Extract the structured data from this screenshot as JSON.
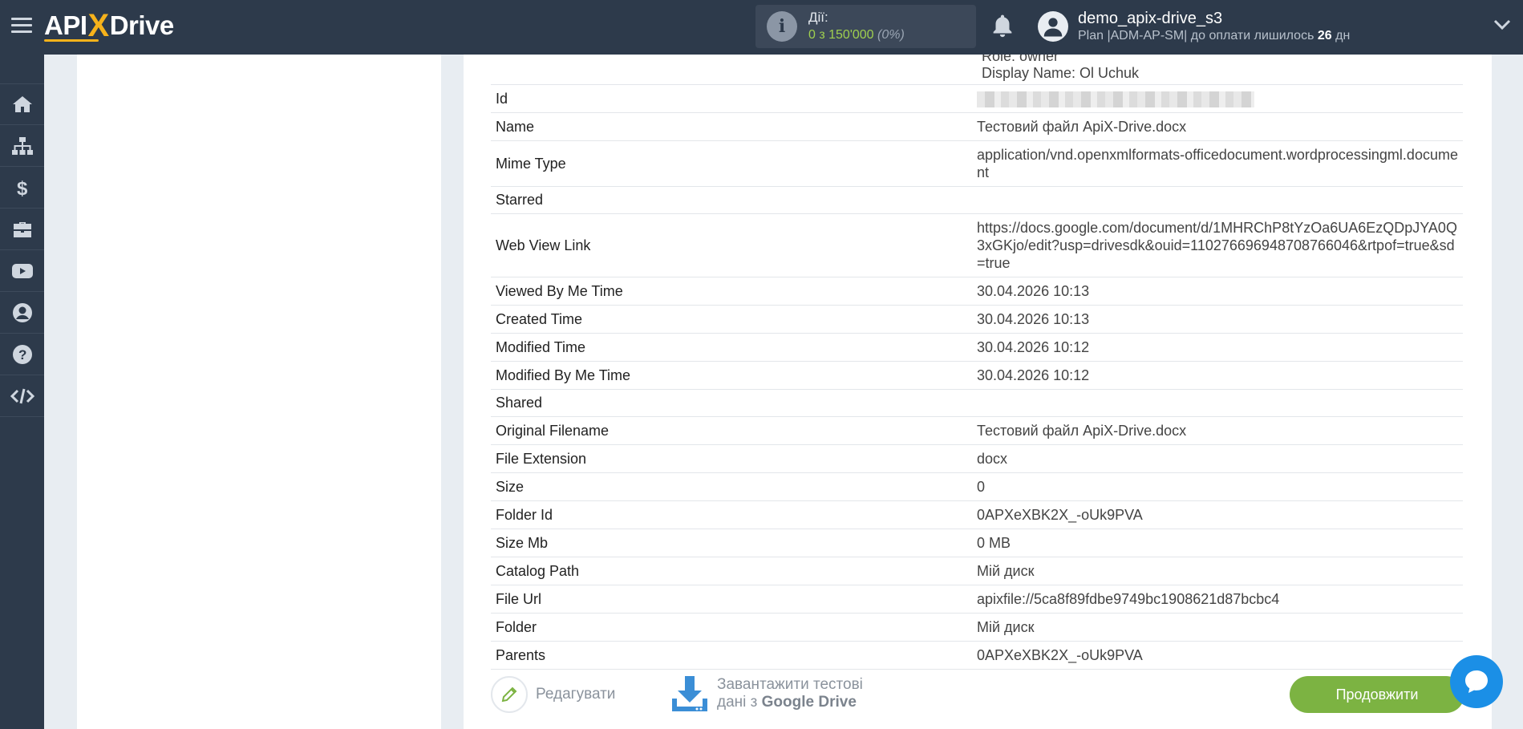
{
  "header": {
    "logo_text_left": "API",
    "logo_text_x": "X",
    "logo_text_right": "Drive",
    "actions_title": "Дії:",
    "actions_count": "0 з 150'000",
    "actions_percent": "(0%)",
    "user_name": "demo_apix-drive_s3",
    "user_plan": "Plan |ADM-AP-SM| до оплати лишилось",
    "user_days": "26",
    "user_days_unit": "дн"
  },
  "sidebar": {
    "items": [
      "home-icon",
      "sitemap-icon",
      "dollar-icon",
      "briefcase-icon",
      "youtube-icon",
      "user-icon",
      "help-icon",
      "code-icon"
    ]
  },
  "details": {
    "clipped_line": "Role: owner",
    "display_name": "Display Name: Ol Uchuk",
    "rows": [
      {
        "key": "Id",
        "value": ""
      },
      {
        "key": "Name",
        "value": "Тестовий файл ApiX-Drive.docx"
      },
      {
        "key": "Mime Type",
        "value": "application/vnd.openxmlformats-officedocument.wordprocessingml.document"
      },
      {
        "key": "Starred",
        "value": ""
      },
      {
        "key": "Web View Link",
        "value": "https://docs.google.com/document/d/1MHRChP8tYzOa6UA6EzQDpJYA0Q3xGKjo/edit?usp=drivesdk&ouid=110276696948708766046&rtpof=true&sd=true"
      },
      {
        "key": "Viewed By Me Time",
        "value": "30.04.2026 10:13"
      },
      {
        "key": "Created Time",
        "value": "30.04.2026 10:13"
      },
      {
        "key": "Modified Time",
        "value": "30.04.2026 10:12"
      },
      {
        "key": "Modified By Me Time",
        "value": "30.04.2026 10:12"
      },
      {
        "key": "Shared",
        "value": ""
      },
      {
        "key": "Original Filename",
        "value": "Тестовий файл ApiX-Drive.docx"
      },
      {
        "key": "File Extension",
        "value": "docx"
      },
      {
        "key": "Size",
        "value": "0"
      },
      {
        "key": "Folder Id",
        "value": "0APXeXBK2X_-oUk9PVA"
      },
      {
        "key": "Size Mb",
        "value": "0 MB"
      },
      {
        "key": "Catalog Path",
        "value": "Мій диск"
      },
      {
        "key": "File Url",
        "value": "apixfile://5ca8f89fdbe9749bc1908621d87bcbc4"
      },
      {
        "key": "Folder",
        "value": "Мій диск"
      },
      {
        "key": "Parents",
        "value": "0APXeXBK2X_-oUk9PVA"
      }
    ]
  },
  "footer": {
    "edit_label": "Редагувати",
    "download_line1": "Завантажити тестові",
    "download_line2_prefix": "дані з",
    "download_line2_service": "Google Drive",
    "continue_label": "Продовжити"
  },
  "colors": {
    "topbar": "#2d3a4b",
    "accent_green": "#7cb342",
    "brand_yellow": "#f6b21b",
    "chat_blue": "#1b8fe6"
  }
}
